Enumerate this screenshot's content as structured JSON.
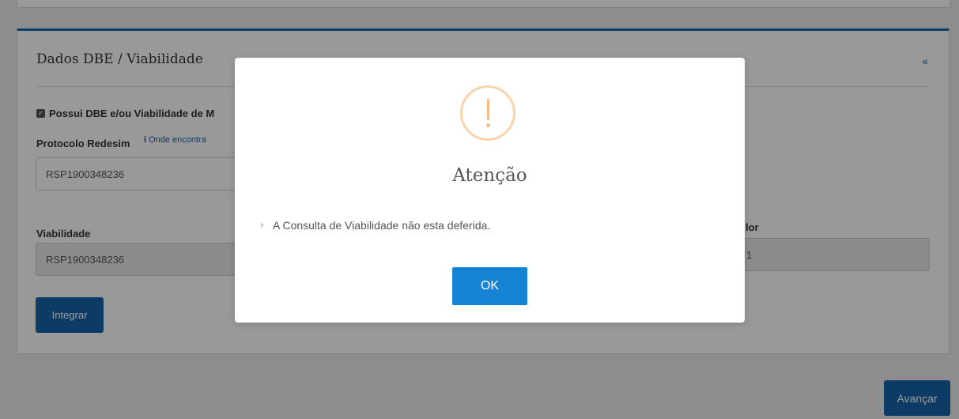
{
  "section": {
    "title": "Dados DBE / Viabilidade",
    "collapse_icon": "«"
  },
  "form": {
    "checkbox_label": "Possui DBE e/ou Viabilidade de M",
    "protocolo_label": "Protocolo Redesim",
    "help_icon": "i",
    "help_link": "Onde encontra",
    "protocolo_value": "RSP1900348236",
    "viabilidade_label": "Viabilidade",
    "viabilidade_value": "RSP1900348236",
    "right_label_partial": "lor",
    "right_value_partial": "1",
    "integrar_button": "Integrar"
  },
  "footer": {
    "avancar_button": "Avançar"
  },
  "modal": {
    "icon": "warning-icon",
    "icon_symbol": "!",
    "title": "Atenção",
    "message": "A Consulta de Viabilidade não esta deferida.",
    "ok_button": "OK"
  }
}
